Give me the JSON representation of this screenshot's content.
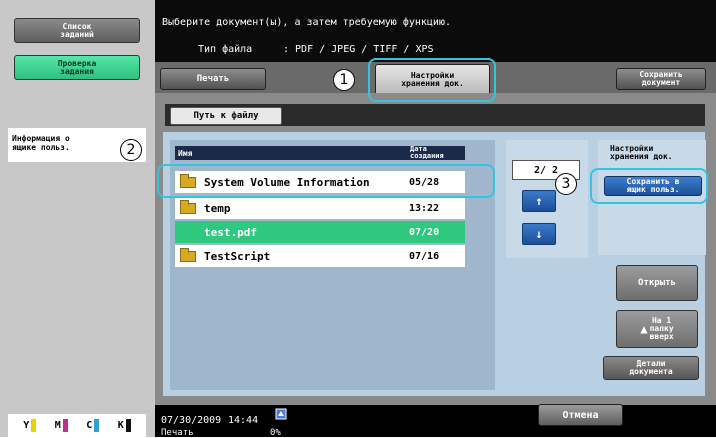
{
  "left_panel": {
    "job_list_label": "Список\nзаданий",
    "check_job_label": "Проверка\nзадания",
    "info_text": "Информация о\nящике польз.",
    "toner": [
      {
        "letter": "Y",
        "color": "#e8d400"
      },
      {
        "letter": "M",
        "color": "#c22d8c"
      },
      {
        "letter": "C",
        "color": "#2fa0d8"
      },
      {
        "letter": "K",
        "color": "#111111"
      }
    ]
  },
  "header": {
    "instruction": "Выберите документ(ы), а затем требуемую функцию.",
    "filetype_label": "Тип файла",
    "filetype_value": ": PDF / JPEG / TIFF / XPS"
  },
  "tabs": {
    "print": "Печать",
    "storage_settings": "Настройки\nхранения док.",
    "save_document": "Сохранить\nдокумент"
  },
  "path": {
    "button_label": "Путь к файлу"
  },
  "file_list": {
    "header_name": "Имя",
    "header_date": "Дата\nсоздания",
    "rows": [
      {
        "name": "System Volume Information",
        "date": "05/28",
        "folder": true,
        "selected": false
      },
      {
        "name": "temp",
        "date": "13:22",
        "folder": true,
        "selected": false
      },
      {
        "name": "test.pdf",
        "date": "07/20",
        "folder": false,
        "selected": true
      },
      {
        "name": "TestScript",
        "date": "07/16",
        "folder": true,
        "selected": false
      }
    ]
  },
  "scroll": {
    "page": "2/ 2",
    "up": "↑",
    "down": "↓"
  },
  "settings": {
    "label": "Настройки\nхранения док.",
    "save_box_label": "Сохранить в\nящик польз."
  },
  "side_buttons": {
    "open": "Открыть",
    "up_folder": "На 1\nпапку\nвверх",
    "details": "Детали\nдокумента"
  },
  "status": {
    "date": "07/30/2009",
    "time": "14:44",
    "print": "Печать",
    "percent": "0%",
    "cancel": "Отмена"
  },
  "callouts": [
    "1",
    "2",
    "3"
  ]
}
